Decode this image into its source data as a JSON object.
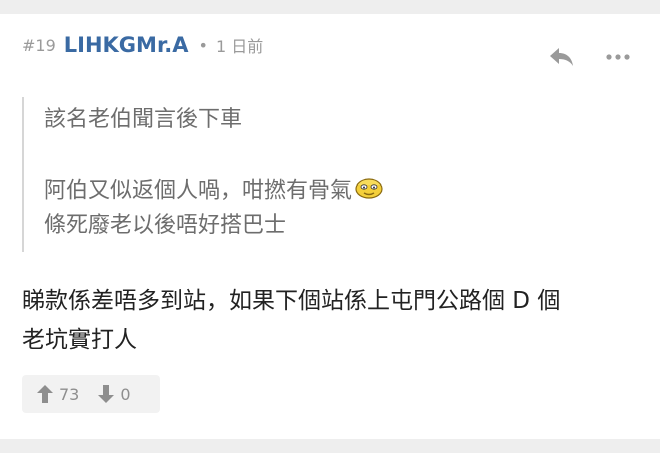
{
  "post": {
    "floor": "#19",
    "username": "LIHKGMr.A",
    "separator": "•",
    "time": "1 日前",
    "quote_lines": [
      "該名老伯聞言後下車",
      "阿伯又似返個人喎，咁撚有骨氣",
      "條死廢老以後唔好搭巴士"
    ],
    "body_lines": [
      "睇款係差唔多到站，如果下個站係上屯門公路個 D 個",
      "老坑實打人"
    ]
  },
  "votes": {
    "up_count": "73",
    "down_count": "0"
  },
  "icons": {
    "reply": "reply-arrow-icon",
    "more": "more-dots-icon",
    "emoji": "emoji-face-icon",
    "upvote": "thumb-up-arrow-icon",
    "downvote": "thumb-down-arrow-icon"
  },
  "colors": {
    "username": "#3a6aa3",
    "meta": "#9a9a9a",
    "quote_text": "#6d6d6d",
    "body_text": "#222222",
    "page_background": "#eeeeee",
    "card_background": "#ffffff"
  }
}
